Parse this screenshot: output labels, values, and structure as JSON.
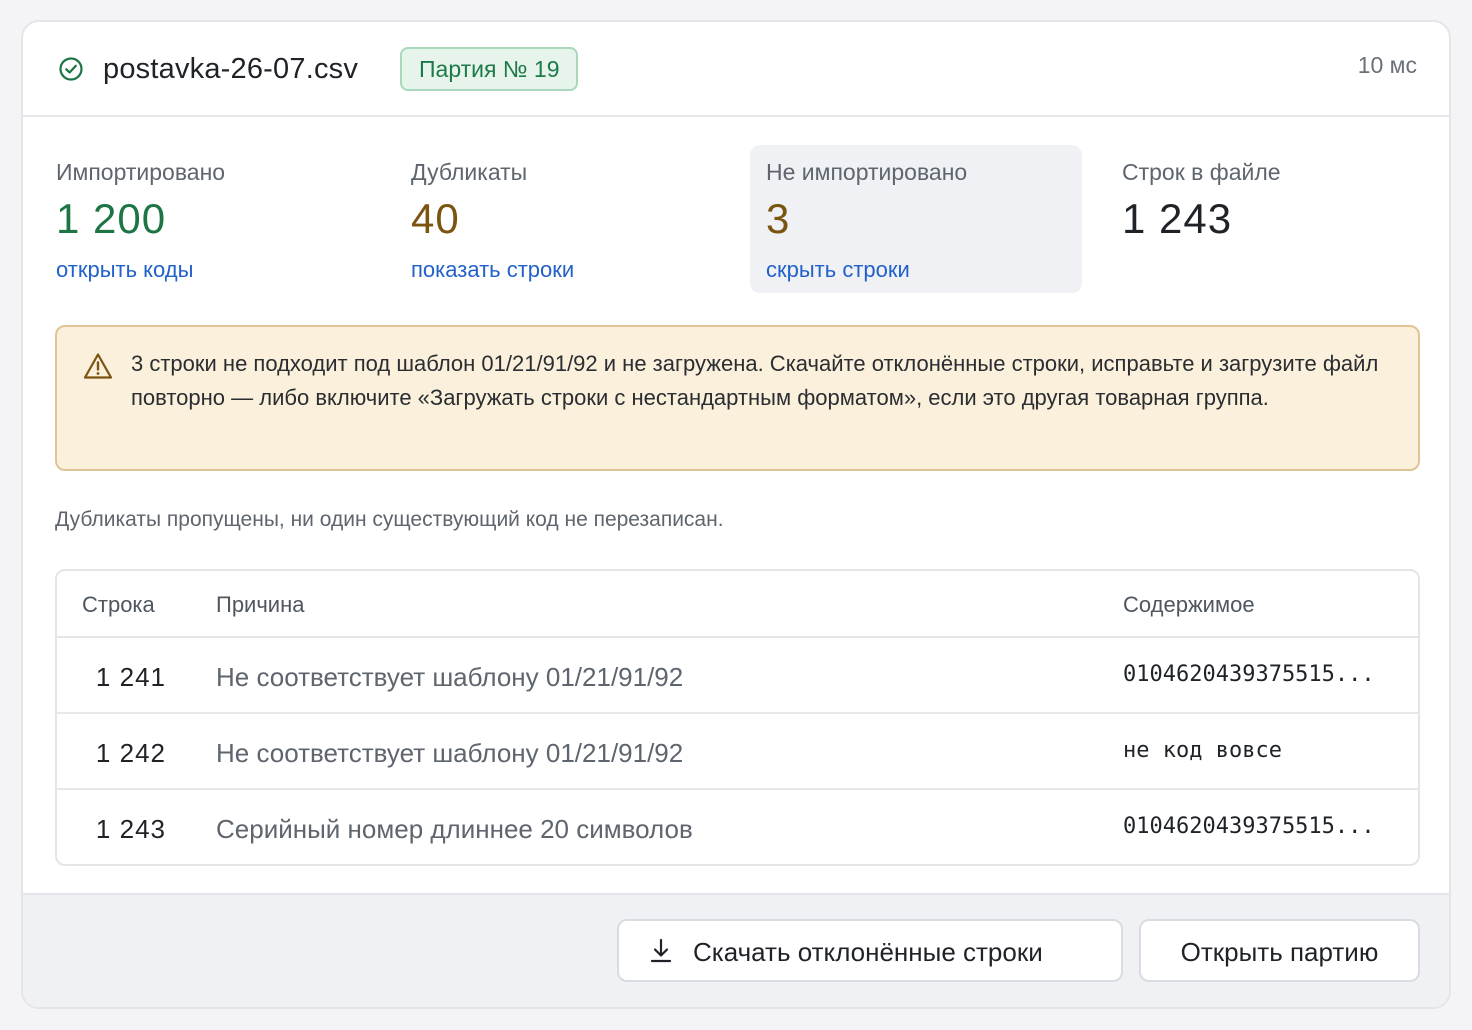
{
  "header": {
    "file_name": "postavka-26-07.csv",
    "batch_badge": "Партия № 19",
    "duration": "10 мс",
    "status_icon": "check-circle-icon",
    "accent_color": "#1c7543"
  },
  "stats": [
    {
      "label": "Импортировано",
      "value": "1 200",
      "link": "открыть коды",
      "color": "#1c7543"
    },
    {
      "label": "Дубликаты",
      "value": "40",
      "link": "показать строки",
      "color": "#7a5410"
    },
    {
      "label": "Не импортировано",
      "value": "3",
      "link": "скрыть строки",
      "color": "#7a5410",
      "active": true
    },
    {
      "label": "Строк в файле",
      "value": "1 243",
      "color": "#1f2328"
    }
  ],
  "alert": {
    "icon": "warning-triangle-icon",
    "text": "3 строки не подходит под шаблон 01/21/91/92 и не загружена. Скачайте отклонённые строки, исправьте и загрузите файл повторно — либо включите «Загружать строки с нестандартным форматом», если это другая товарная группа."
  },
  "note": "Дубликаты пропущены, ни один существующий код не перезаписан.",
  "table": {
    "columns": [
      "Строка",
      "Причина",
      "Содержимое"
    ],
    "rows": [
      {
        "line": "1 241",
        "reason": "Не соответствует шаблону 01/21/91/92",
        "content": "0104620439375515..."
      },
      {
        "line": "1 242",
        "reason": "Не соответствует шаблону 01/21/91/92",
        "content": "не код вовсе"
      },
      {
        "line": "1 243",
        "reason": "Серийный номер длиннее 20 символов",
        "content": "0104620439375515..."
      }
    ]
  },
  "footer": {
    "download_label": "Скачать отклонённые строки",
    "download_icon": "download-icon",
    "open_label": "Открыть партию"
  }
}
